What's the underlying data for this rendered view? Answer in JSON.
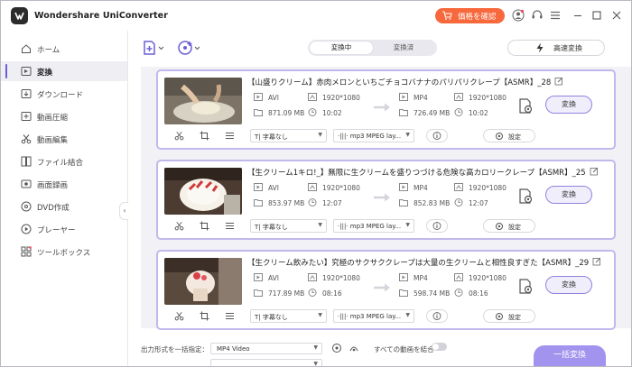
{
  "app": {
    "title": "Wondershare UniConverter",
    "price_label": "価格を確認"
  },
  "sidebar": {
    "items": [
      {
        "label": "ホーム",
        "icon": "home-icon",
        "active": false
      },
      {
        "label": "変換",
        "icon": "convert-icon",
        "active": true
      },
      {
        "label": "ダウンロード",
        "icon": "download-icon",
        "active": false
      },
      {
        "label": "動画圧縮",
        "icon": "compress-icon",
        "active": false
      },
      {
        "label": "動画編集",
        "icon": "scissors-icon",
        "active": false
      },
      {
        "label": "ファイル結合",
        "icon": "merge-icon",
        "active": false
      },
      {
        "label": "画面録画",
        "icon": "screen-record-icon",
        "active": false
      },
      {
        "label": "DVD作成",
        "icon": "dvd-icon",
        "active": false
      },
      {
        "label": "プレーヤー",
        "icon": "player-icon",
        "active": false
      },
      {
        "label": "ツールボックス",
        "icon": "toolbox-icon",
        "active": false
      }
    ]
  },
  "tabs": {
    "converting": "変換中",
    "converted": "変換済"
  },
  "high_speed": "高速変換",
  "files": [
    {
      "title": "【山盛りクリーム】赤肉メロンといちごチョコバナナのパリパリクレープ【ASMR】_28",
      "src": {
        "format": "AVI",
        "resolution": "1920*1080",
        "size": "871.09 MB",
        "duration": "10:02"
      },
      "out": {
        "format": "MP4",
        "resolution": "1920*1080",
        "size": "726.49 MB",
        "duration": "10:02"
      },
      "subtitle": "字幕なし",
      "audio": "mp3 MPEG lay...",
      "settings": "設定",
      "convert": "変換"
    },
    {
      "title": "【生クリーム1キロ!_】無限に生クリームを盛りつづける危険な高カロリークレープ【ASMR】_25",
      "src": {
        "format": "AVI",
        "resolution": "1920*1080",
        "size": "853.97 MB",
        "duration": "12:07"
      },
      "out": {
        "format": "MP4",
        "resolution": "1920*1080",
        "size": "852.83 MB",
        "duration": "12:07"
      },
      "subtitle": "字幕なし",
      "audio": "mp3 MPEG lay...",
      "settings": "設定",
      "convert": "変換"
    },
    {
      "title": "【生クリーム飲みたい】究極のサクサククレープは大量の生クリームと相性良すぎた【ASMR】_29",
      "src": {
        "format": "AVI",
        "resolution": "1920*1080",
        "size": "717.89 MB",
        "duration": "08:16"
      },
      "out": {
        "format": "MP4",
        "resolution": "1920*1080",
        "size": "598.74 MB",
        "duration": "08:16"
      },
      "subtitle": "字幕なし",
      "audio": "mp3 MPEG lay...",
      "settings": "設定",
      "convert": "変換"
    }
  ],
  "bottom": {
    "output_format_label": "出力形式を一括指定：",
    "output_format_value": "MP4 Video",
    "merge_label": "すべての動画を結合",
    "convert_all": "一括変換"
  },
  "colors": {
    "accent": "#6b5fd8",
    "price": "#f7683c",
    "card_border": "#c1b9ec",
    "convert_all": "#a193ee"
  }
}
